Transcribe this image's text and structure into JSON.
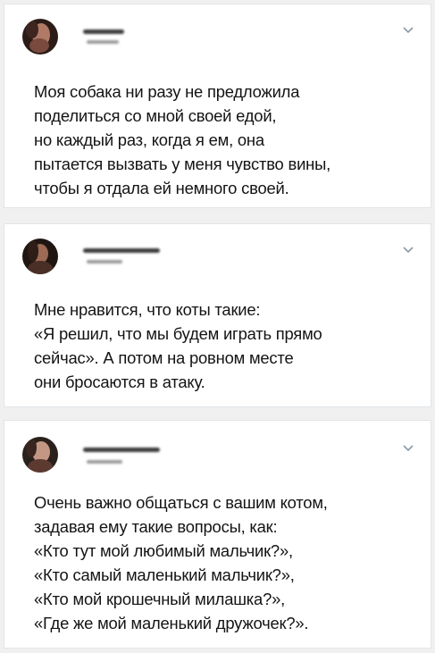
{
  "tweets": [
    {
      "text": "Моя собака ни разу не предложила\nподелиться со мной своей едой,\nно каждый раз, когда я ем, она\nпытается вызвать у меня чувство вины,\nчтобы я отдала ей немного своей.",
      "avatar_icon": "user-avatar-icon",
      "menu_icon": "chevron-down-icon"
    },
    {
      "text": "Мне нравится, что коты такие:\n«Я решил, что мы будем играть прямо\nсейчас». А потом на ровном месте\nони бросаются в атаку.",
      "avatar_icon": "user-avatar-icon",
      "menu_icon": "chevron-down-icon"
    },
    {
      "text": "Очень важно общаться с вашим котом,\nзадавая ему такие вопросы, как:\n«Кто тут мой любимый мальчик?»,\n«Кто самый маленький мальчик?»,\n«Кто мой крошечный милашка?»,\n«Где же мой маленький дружочек?».",
      "avatar_icon": "user-avatar-icon",
      "menu_icon": "chevron-down-icon"
    }
  ],
  "colors": {
    "page_background": "#f0f0f0",
    "card_background": "#ffffff",
    "card_border": "#e1e5e8",
    "text": "#141414",
    "chevron": "#8a9aa6"
  }
}
